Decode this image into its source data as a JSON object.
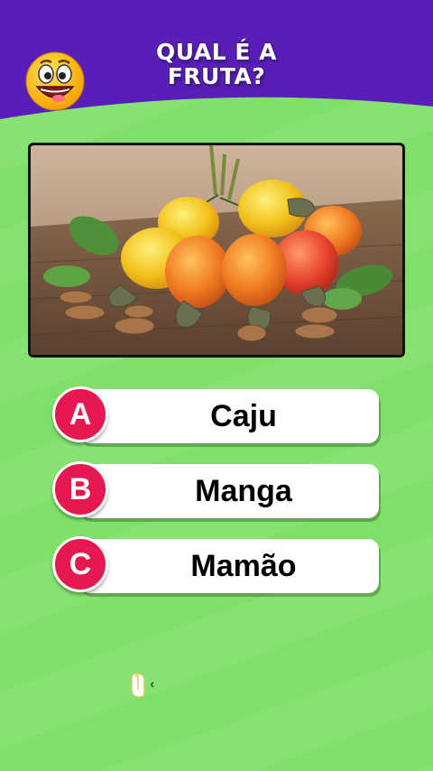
{
  "header": {
    "title": "QUAL É A\nFRUTA?",
    "emoji_icon": "laughing-face-emoji",
    "colors": {
      "banner": "#5a1eb8",
      "background": "#7ee068"
    }
  },
  "question_image": {
    "subject": "cashew-fruit-photo"
  },
  "answers": [
    {
      "letter": "A",
      "text": "Caju"
    },
    {
      "letter": "B",
      "text": "Manga"
    },
    {
      "letter": "C",
      "text": "Mamão"
    }
  ],
  "accent_color": "#e5184f"
}
